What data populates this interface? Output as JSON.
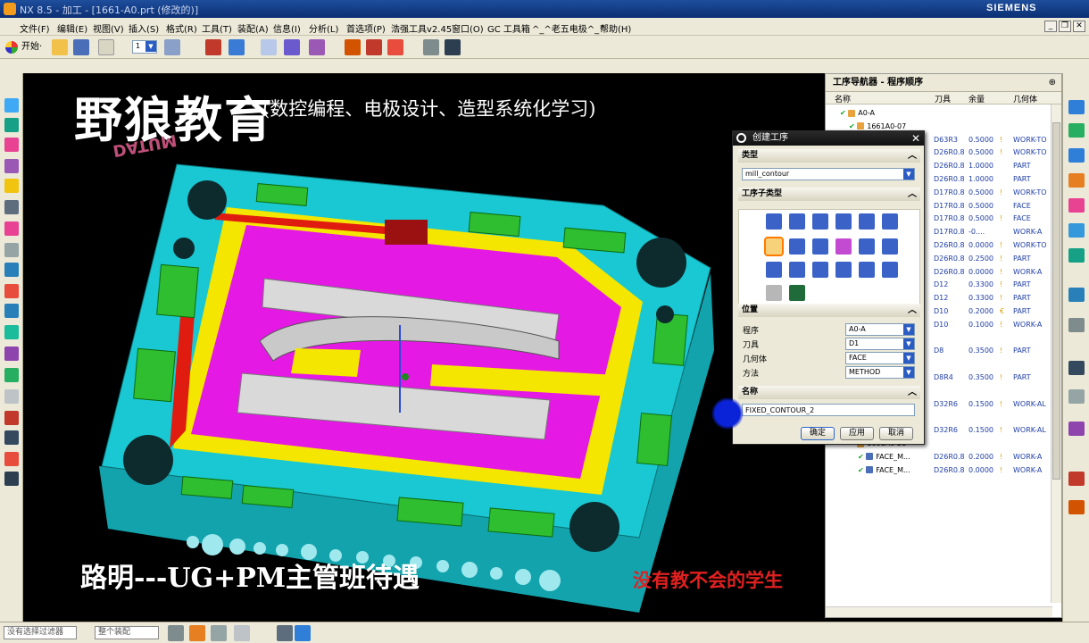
{
  "titlebar": {
    "title": "NX 8.5 - 加工 - [1661-A0.prt (修改的)]",
    "brand": "SIEMENS"
  },
  "menu": [
    "文件(F)",
    "编辑(E)",
    "视图(V)",
    "插入(S)",
    "格式(R)",
    "工具(T)",
    "装配(A)",
    "信息(I)",
    "分析(L)",
    "首选项(P)",
    "浩强工具v2.45",
    "窗口(O)",
    "GC 工具箱",
    "^_^老五电极^_^",
    "帮助(H)"
  ],
  "toolbar": {
    "start_label": "开始·",
    "layer_value": "1"
  },
  "watermark": {
    "title": "野狼教育",
    "subtitle": "(数控编程、电极设计、造型系统化学习)",
    "datum": "DATUM",
    "bottom": "路明---UG+PM主管班待遇",
    "bottom_right": "没有教不会的学生"
  },
  "navigator": {
    "title": "工序导航器 - 程序顺序",
    "columns": {
      "name": "名称",
      "tool": "刀具",
      "stock": "余量",
      "geo": "几何体"
    },
    "rows": [
      {
        "indent": 1,
        "icon": "program",
        "name": "A0-A",
        "tool": "",
        "stock": "",
        "mark": "",
        "geo": ""
      },
      {
        "indent": 2,
        "icon": "program",
        "name": "1661A0-07",
        "tool": "",
        "stock": "",
        "mark": "",
        "geo": ""
      },
      {
        "indent": 3,
        "icon": "op",
        "name": "",
        "tool": "D63R3",
        "stock": "0.5000",
        "mark": "!",
        "geo": "WORK-TO"
      },
      {
        "indent": 3,
        "icon": "op",
        "name": "",
        "tool": "D26R0.8",
        "stock": "0.5000",
        "mark": "!",
        "geo": "WORK-TO"
      },
      {
        "indent": 3,
        "icon": "op",
        "name": "",
        "tool": "D26R0.8",
        "stock": "1.0000",
        "mark": "",
        "geo": "PART"
      },
      {
        "indent": 3,
        "icon": "op",
        "name": "",
        "tool": "D26R0.8",
        "stock": "1.0000",
        "mark": "",
        "geo": "PART"
      },
      {
        "indent": 3,
        "icon": "op",
        "name": "",
        "tool": "D17R0.8",
        "stock": "0.5000",
        "mark": "!",
        "geo": "WORK-TO"
      },
      {
        "indent": 3,
        "icon": "op",
        "name": "",
        "tool": "D17R0.8",
        "stock": "0.5000",
        "mark": "",
        "geo": "FACE"
      },
      {
        "indent": 3,
        "icon": "op",
        "name": "",
        "tool": "D17R0.8",
        "stock": "0.5000",
        "mark": "!",
        "geo": "FACE"
      },
      {
        "indent": 3,
        "icon": "op",
        "name": "",
        "tool": "D17R0.8",
        "stock": "-0....",
        "mark": "",
        "geo": "WORK-A"
      },
      {
        "indent": 3,
        "icon": "op",
        "name": "",
        "tool": "D26R0.8",
        "stock": "0.0000",
        "mark": "!",
        "geo": "WORK-TO"
      },
      {
        "indent": 3,
        "icon": "op",
        "name": "",
        "tool": "D26R0.8",
        "stock": "0.2500",
        "mark": "!",
        "geo": "PART"
      },
      {
        "indent": 3,
        "icon": "op",
        "name": "",
        "tool": "D26R0.8",
        "stock": "0.0000",
        "mark": "!",
        "geo": "WORK-A"
      },
      {
        "indent": 3,
        "icon": "op",
        "name": "",
        "tool": "D12",
        "stock": "0.3300",
        "mark": "!",
        "geo": "PART"
      },
      {
        "indent": 3,
        "icon": "op",
        "name": "",
        "tool": "D12",
        "stock": "0.3300",
        "mark": "!",
        "geo": "PART"
      },
      {
        "indent": 3,
        "icon": "op",
        "name": "",
        "tool": "D10",
        "stock": "0.2000",
        "mark": "€",
        "geo": "PART"
      },
      {
        "indent": 3,
        "icon": "op",
        "name": "",
        "tool": "D10",
        "stock": "0.1000",
        "mark": "!",
        "geo": "WORK-A"
      },
      {
        "indent": 2,
        "icon": "program",
        "name": "1661A0-17",
        "tool": "",
        "stock": "",
        "mark": "",
        "geo": ""
      },
      {
        "indent": 3,
        "icon": "op",
        "name": "CAV-L4...",
        "tool": "D8",
        "stock": "0.3500",
        "mark": "!",
        "geo": "PART"
      },
      {
        "indent": 2,
        "icon": "program",
        "name": "1661A0-18",
        "tool": "",
        "stock": "",
        "mark": "",
        "geo": ""
      },
      {
        "indent": 3,
        "icon": "op",
        "name": "CAV-L4...",
        "tool": "D8R4",
        "stock": "0.3500",
        "mark": "!",
        "geo": "PART"
      },
      {
        "indent": 2,
        "icon": "program",
        "name": "1661A0-19",
        "tool": "",
        "stock": "",
        "mark": "",
        "geo": ""
      },
      {
        "indent": 3,
        "icon": "op",
        "name": "FIXED_...",
        "tool": "D32R6",
        "stock": "0.1500",
        "mark": "!",
        "geo": "WORK-AL"
      },
      {
        "indent": 2,
        "icon": "blocked",
        "name": "1661A0-20",
        "tool": "",
        "stock": "",
        "mark": "",
        "geo": ""
      },
      {
        "indent": 3,
        "icon": "blocked",
        "name": "FIXED_...",
        "tool": "D32R6",
        "stock": "0.1500",
        "mark": "!",
        "geo": "WORK-AL"
      },
      {
        "indent": 2,
        "icon": "program",
        "name": "1661A0-21",
        "tool": "",
        "stock": "",
        "mark": "",
        "geo": ""
      },
      {
        "indent": 3,
        "icon": "op",
        "name": "FACE_M...",
        "tool": "D26R0.8",
        "stock": "0.2000",
        "mark": "!",
        "geo": "WORK-A"
      },
      {
        "indent": 3,
        "icon": "op",
        "name": "FACE_M...",
        "tool": "D26R0.8",
        "stock": "0.0000",
        "mark": "!",
        "geo": "WORK-A"
      }
    ]
  },
  "dialog": {
    "title": "创建工序",
    "type_section": "类型",
    "type_value": "mill_contour",
    "subtype_section": "工序子类型",
    "position_section": "位置",
    "fields": [
      {
        "label": "程序",
        "value": "A0-A"
      },
      {
        "label": "刀具",
        "value": "D1"
      },
      {
        "label": "几何体",
        "value": "FACE"
      },
      {
        "label": "方法",
        "value": "METHOD"
      }
    ],
    "name_section": "名称",
    "name_value": "FIXED_CONTOUR_2",
    "ok": "确定",
    "apply": "应用",
    "cancel": "取消"
  },
  "statusbar": {
    "filter_value": "没有选择过滤器",
    "scope_value": "整个装配"
  },
  "colors": {
    "cyan": "#19c8d2",
    "magenta": "#e419e4",
    "yellow": "#f5e600",
    "green": "#2fbe2f",
    "red": "#e01b10"
  }
}
